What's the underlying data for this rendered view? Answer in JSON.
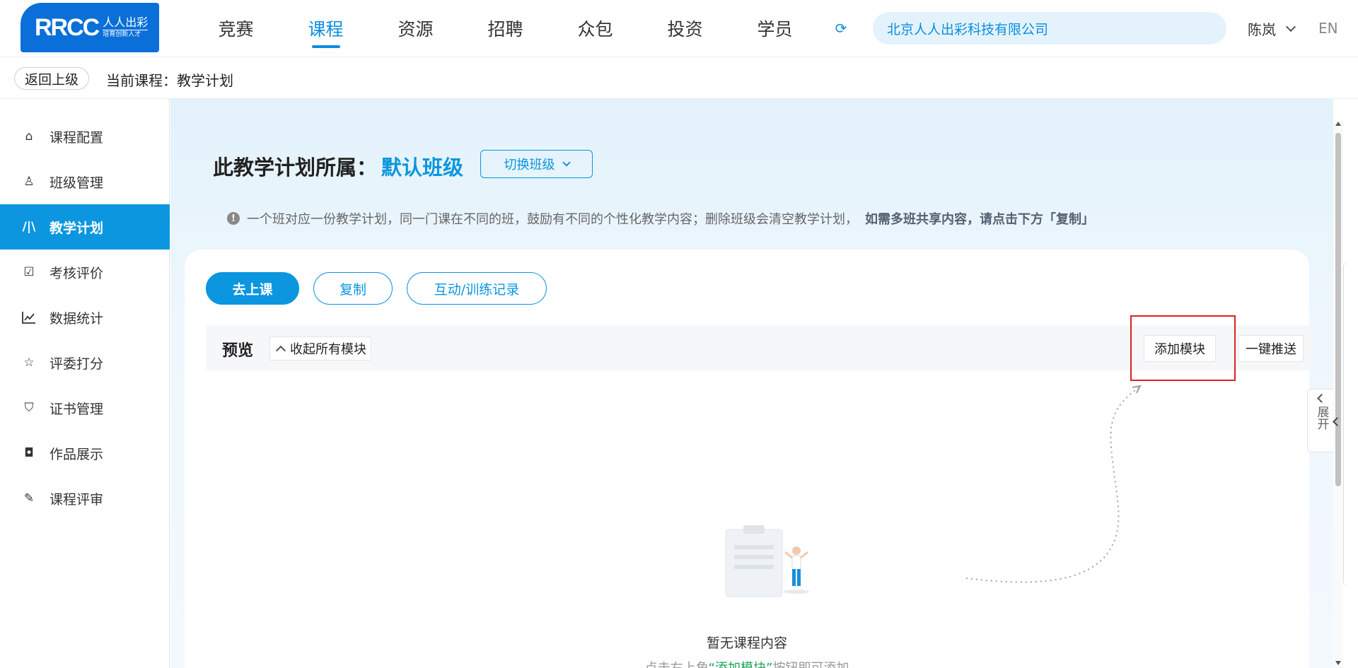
{
  "logo": {
    "main": "RRCC",
    "cn": "人人出彩",
    "sub": "培育创新人才"
  },
  "nav": [
    {
      "label": "竞赛"
    },
    {
      "label": "课程",
      "active": true
    },
    {
      "label": "资源"
    },
    {
      "label": "招聘"
    },
    {
      "label": "众包"
    },
    {
      "label": "投资"
    },
    {
      "label": "学员"
    }
  ],
  "header": {
    "company": "北京人人出彩科技有限公司",
    "user": "陈岚",
    "lang": "EN",
    "refresh_icon": "refresh-icon"
  },
  "breadcrumb": {
    "back": "返回上级",
    "current": "当前课程：教学计划"
  },
  "sidebar": {
    "items": [
      {
        "label": "课程配置",
        "icon": "home-icon",
        "glyph": "⌂"
      },
      {
        "label": "班级管理",
        "icon": "user-search-icon",
        "glyph": "♙"
      },
      {
        "label": "教学计划",
        "icon": "books-icon",
        "glyph": "/|\\",
        "active": true
      },
      {
        "label": "考核评价",
        "icon": "calendar-check-icon",
        "glyph": "☑"
      },
      {
        "label": "数据统计",
        "icon": "line-chart-icon",
        "glyph": "📈"
      },
      {
        "label": "评委打分",
        "icon": "star-pointer-icon",
        "glyph": "☆"
      },
      {
        "label": "证书管理",
        "icon": "shield-check-icon",
        "glyph": "⛉"
      },
      {
        "label": "作品展示",
        "icon": "camera-icon",
        "glyph": "◘"
      },
      {
        "label": "课程评审",
        "icon": "edit-doc-icon",
        "glyph": "✎"
      }
    ]
  },
  "main": {
    "title_prefix": "此教学计划所属：",
    "class_name": "默认班级",
    "switch_label": "切换班级",
    "notice": "一个班对应一份教学计划，同一门课在不同的班，鼓励有不同的个性化教学内容；删除班级会清空教学计划，",
    "notice_strong": "如需多班共享内容，请点击下方「复制」",
    "actions": {
      "go_class": "去上课",
      "copy": "复制",
      "records": "互动/训练记录"
    },
    "preview": {
      "label": "预览",
      "collapse": "收起所有模块",
      "add_module": "添加模块",
      "push": "一键推送"
    },
    "empty": {
      "title": "暂无课程内容",
      "hint_pre": "点击右上角",
      "hint_hl": "“添加模块”",
      "hint_post": "按钮即可添加"
    },
    "float": {
      "text": "展开"
    }
  },
  "colors": {
    "accent": "#0b96df",
    "highlight": "#e02020",
    "hint_green": "#1aa35a"
  }
}
